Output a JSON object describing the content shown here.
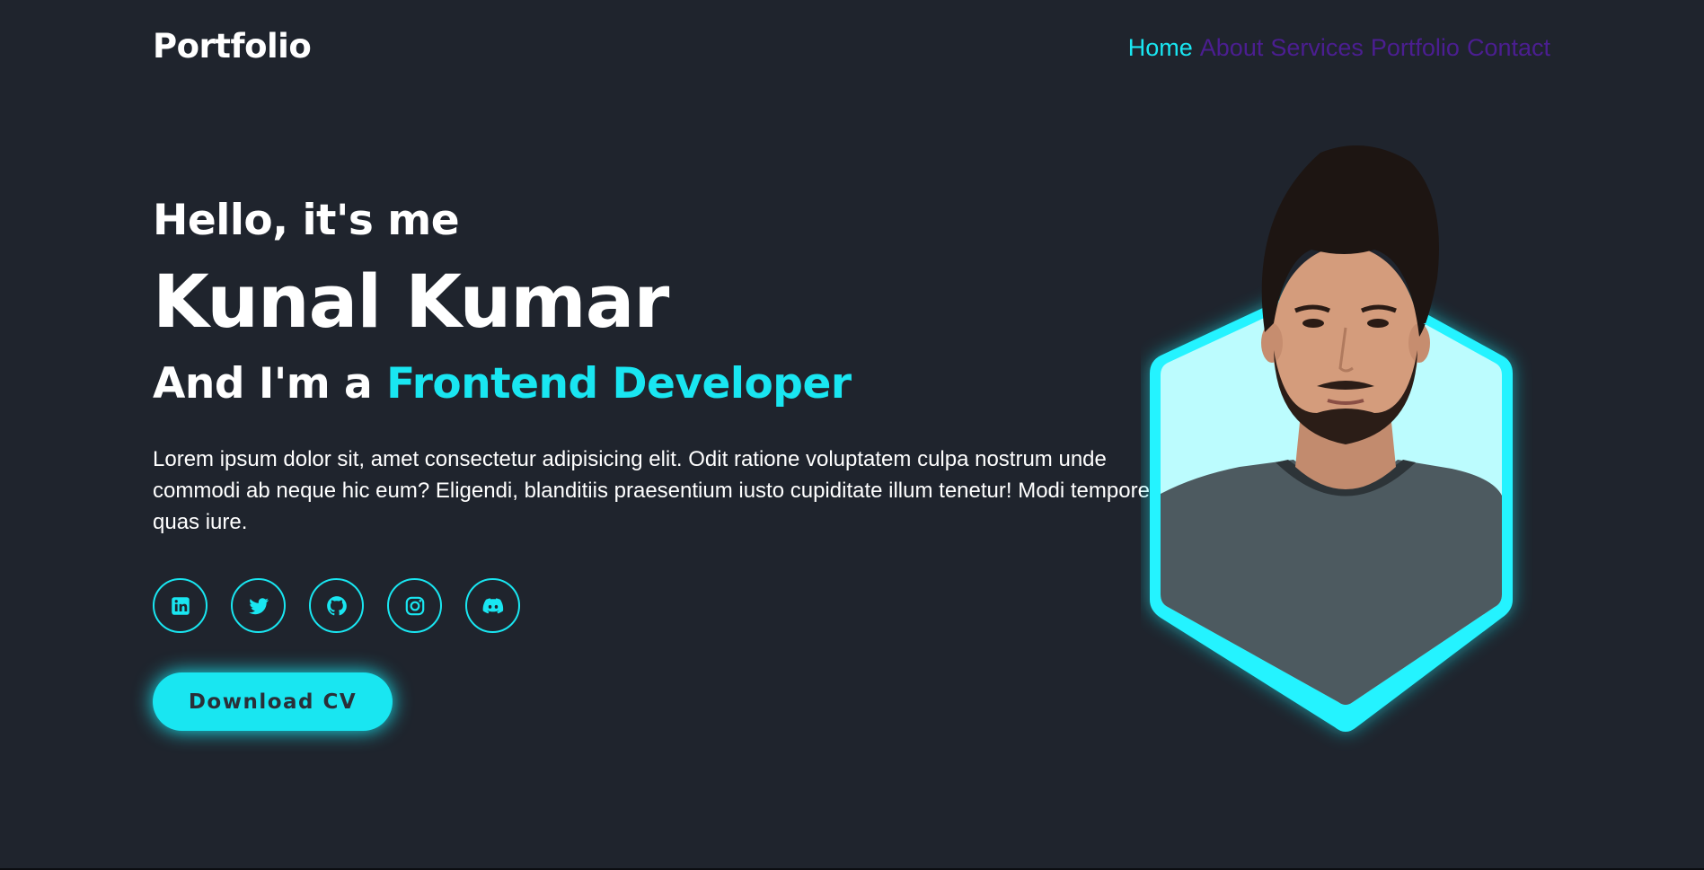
{
  "header": {
    "logo": "Portfolio",
    "nav": [
      {
        "label": "Home",
        "active": true
      },
      {
        "label": "About",
        "active": false
      },
      {
        "label": "Services",
        "active": false
      },
      {
        "label": "Portfolio",
        "active": false
      },
      {
        "label": "Contact",
        "active": false
      }
    ]
  },
  "hero": {
    "greeting": "Hello, it's me",
    "name": "Kunal Kumar",
    "role_prefix": "And I'm a",
    "role_highlight": "Frontend Developer",
    "description": "Lorem ipsum dolor sit, amet consectetur adipisicing elit. Odit ratione voluptatem culpa nostrum unde commodi ab neque hic eum? Eligendi, blanditiis praesentium iusto cupiditate illum tenetur! Modi tempore quas iure.",
    "socials": [
      "linkedin-icon",
      "twitter-icon",
      "github-icon",
      "instagram-icon",
      "discord-icon"
    ],
    "cta_label": "Download CV"
  },
  "colors": {
    "background": "#1f242d",
    "accent": "#19e6f1",
    "nav_inactive": "#4b1e91",
    "text": "#ffffff"
  }
}
